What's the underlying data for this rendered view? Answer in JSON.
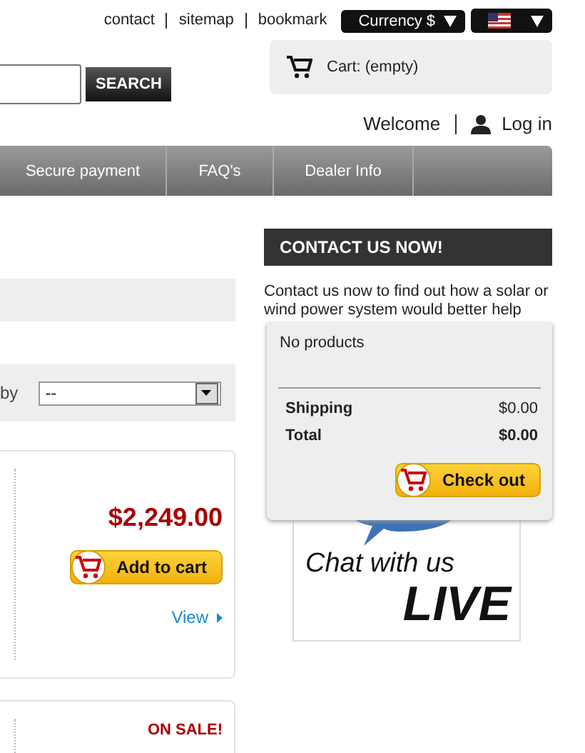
{
  "top_links": [
    {
      "label": "contact"
    },
    {
      "label": "sitemap"
    },
    {
      "label": "bookmark"
    }
  ],
  "currency": {
    "label": "Currency $"
  },
  "search": {
    "button": "SEARCH"
  },
  "cart": {
    "label": "Cart: (empty)"
  },
  "account": {
    "welcome": "Welcome",
    "login": "Log in"
  },
  "nav": [
    {
      "label": "Secure payment"
    },
    {
      "label": "FAQ's"
    },
    {
      "label": "Dealer Info"
    }
  ],
  "sort": {
    "label": "by",
    "value": "--"
  },
  "products": [
    {
      "kind": "priced",
      "price": "$2,249.00",
      "button": "Add to cart",
      "link": "View"
    },
    {
      "kind": "sale",
      "badge": "ON SALE!"
    }
  ],
  "contact": {
    "title": "CONTACT US NOW!",
    "text": "Contact us now to find out how a solar or wind power system would better help"
  },
  "chat_banner": {
    "line1": "Chat with us",
    "line2": "LIVE"
  },
  "cart_dropdown": {
    "empty": "No products",
    "rows": [
      {
        "kind": "plain",
        "label": "Shipping",
        "value": "$0.00"
      },
      {
        "kind": "strong",
        "label": "Total",
        "value": "$0.00"
      }
    ],
    "button": "Check out"
  }
}
